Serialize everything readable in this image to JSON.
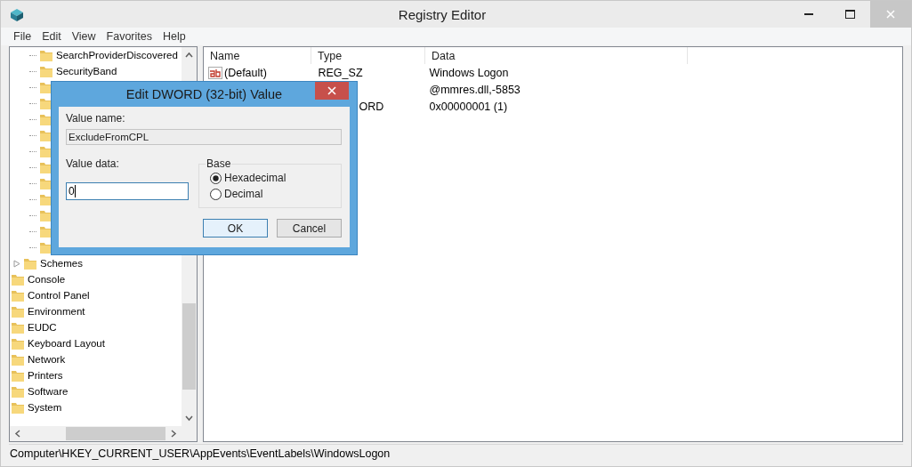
{
  "window": {
    "title": "Registry Editor"
  },
  "menu": [
    "File",
    "Edit",
    "View",
    "Favorites",
    "Help"
  ],
  "tree": {
    "items": [
      {
        "children": [
          {
            "children": [
              {
                "kind": "key",
                "label": "SearchProviderDiscovered"
              },
              {
                "kind": "key",
                "label": "SecurityBand"
              },
              {
                "kind": "covered"
              },
              {
                "kind": "covered"
              },
              {
                "kind": "covered"
              },
              {
                "kind": "covered"
              },
              {
                "kind": "covered"
              },
              {
                "kind": "covered"
              },
              {
                "kind": "covered"
              },
              {
                "kind": "covered"
              },
              {
                "kind": "covered"
              },
              {
                "kind": "covered"
              },
              {
                "kind": "covered"
              }
            ]
          },
          {
            "kind": "key",
            "label": "Schemes",
            "expanded": false
          }
        ]
      },
      {
        "kind": "key",
        "label": "Console"
      },
      {
        "kind": "key",
        "label": "Control Panel"
      },
      {
        "kind": "key",
        "label": "Environment"
      },
      {
        "kind": "key",
        "label": "EUDC"
      },
      {
        "kind": "key",
        "label": "Keyboard Layout"
      },
      {
        "kind": "key",
        "label": "Network"
      },
      {
        "kind": "key",
        "label": "Printers"
      },
      {
        "kind": "key",
        "label": "Software"
      },
      {
        "kind": "key",
        "label": "System"
      }
    ]
  },
  "values": {
    "columns": [
      "Name",
      "Type",
      "Data"
    ],
    "rows": [
      {
        "kind": "string",
        "name": "(Default)",
        "type": "REG_SZ",
        "data": "Windows Logon"
      },
      {
        "data": "@mmres.dll,-5853"
      },
      {
        "type": "ORD",
        "data": "0x00000001 (1)"
      }
    ]
  },
  "dialog": {
    "title": "Edit DWORD (32-bit) Value",
    "value_name_label": "Value name:",
    "value_name": "ExcludeFromCPL",
    "value_data_label": "Value data:",
    "value_data": "0",
    "base_label": "Base",
    "base_options": [
      {
        "label": "Hexadecimal",
        "selected": true
      },
      {
        "label": "Decimal",
        "selected": false
      }
    ],
    "buttons": [
      {
        "label": "OK",
        "default": true
      },
      {
        "label": "Cancel",
        "default": false
      }
    ]
  },
  "status_bar": "Computer\\HKEY_CURRENT_USER\\AppEvents\\EventLabels\\WindowsLogon"
}
